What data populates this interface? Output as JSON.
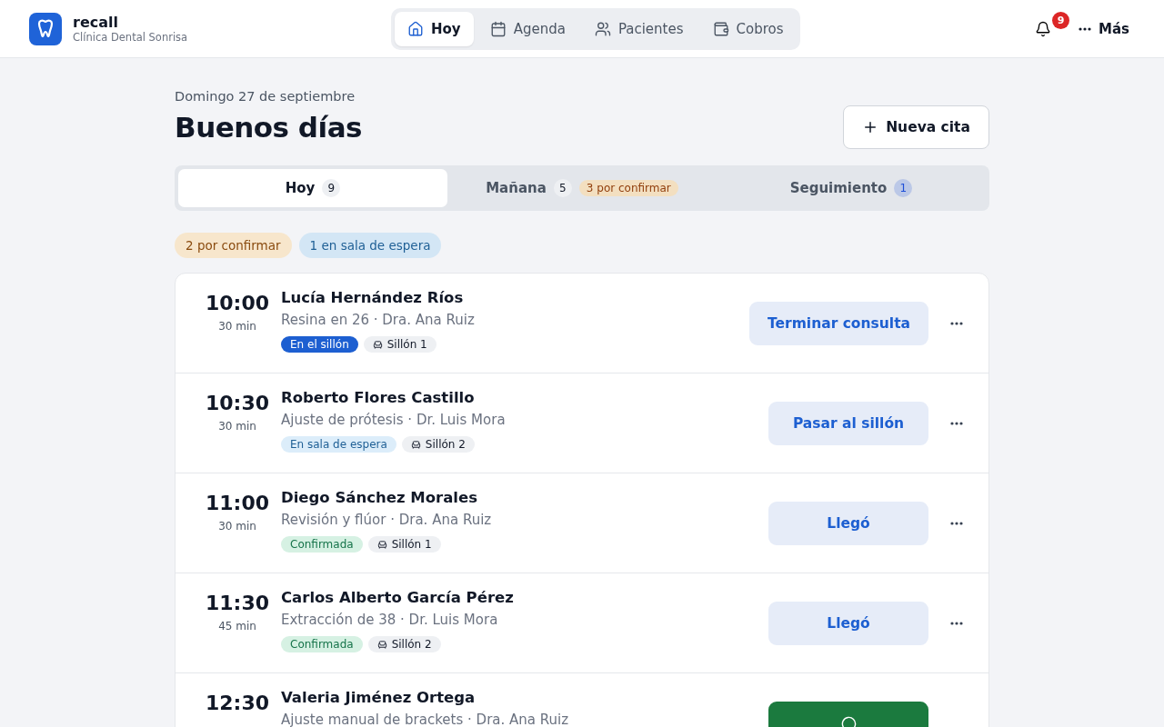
{
  "brand": {
    "name": "recall",
    "clinic": "Clínica Dental Sonrisa"
  },
  "nav": [
    {
      "label": "Hoy",
      "selected": true
    },
    {
      "label": "Agenda",
      "selected": false
    },
    {
      "label": "Pacientes",
      "selected": false
    },
    {
      "label": "Cobros",
      "selected": false
    }
  ],
  "notifications": {
    "count": "9"
  },
  "more": {
    "label": "Más"
  },
  "date": "Domingo 27 de septiembre",
  "greeting": "Buenos días",
  "new_button": {
    "label": "Nueva cita"
  },
  "day_tabs": [
    {
      "label": "Hoy",
      "count": "9",
      "selected": true
    },
    {
      "label": "Mañana",
      "count": "5",
      "badge": "3 por confirmar",
      "selected": false
    },
    {
      "label": "Seguimiento",
      "count": "1",
      "color": "#1d4ed8",
      "selected": false
    }
  ],
  "filters": [
    {
      "label": "2 por confirmar",
      "kind": "pending"
    },
    {
      "label": "1 en sala de espera",
      "kind": "waiting"
    }
  ],
  "appointments": [
    {
      "time": "10:00",
      "duration": "30 min",
      "patient": "Lucía Hernández Ríos",
      "detail": "Resina en 26 · Dra. Ana Ruiz",
      "status": {
        "label": "En el sillón",
        "kind": "in_chair"
      },
      "chair": "Sillón 1",
      "action": {
        "label": "Terminar consulta",
        "kind": "soft"
      }
    },
    {
      "time": "10:30",
      "duration": "30 min",
      "patient": "Roberto Flores Castillo",
      "detail": "Ajuste de prótesis · Dr. Luis Mora",
      "status": {
        "label": "En sala de espera",
        "kind": "waiting"
      },
      "chair": "Sillón 2",
      "action": {
        "label": "Pasar al sillón",
        "kind": "soft"
      }
    },
    {
      "time": "11:00",
      "duration": "30 min",
      "patient": "Diego Sánchez Morales",
      "detail": "Revisión y flúor · Dra. Ana Ruiz",
      "status": {
        "label": "Confirmada",
        "kind": "confirmed"
      },
      "chair": "Sillón 1",
      "action": {
        "label": "Llegó",
        "kind": "soft"
      }
    },
    {
      "time": "11:30",
      "duration": "45 min",
      "patient": "Carlos Alberto García Pérez",
      "detail": "Extracción de 38 · Dr. Luis Mora",
      "status": {
        "label": "Confirmada",
        "kind": "confirmed"
      },
      "chair": "Sillón 2",
      "action": {
        "label": "Llegó",
        "kind": "soft"
      }
    },
    {
      "time": "12:30",
      "patient": "Valeria Jiménez Ortega",
      "detail": "Ajuste manual de brackets · Dra. Ana Ruiz",
      "action": {
        "kind": "whatsapp"
      }
    }
  ]
}
